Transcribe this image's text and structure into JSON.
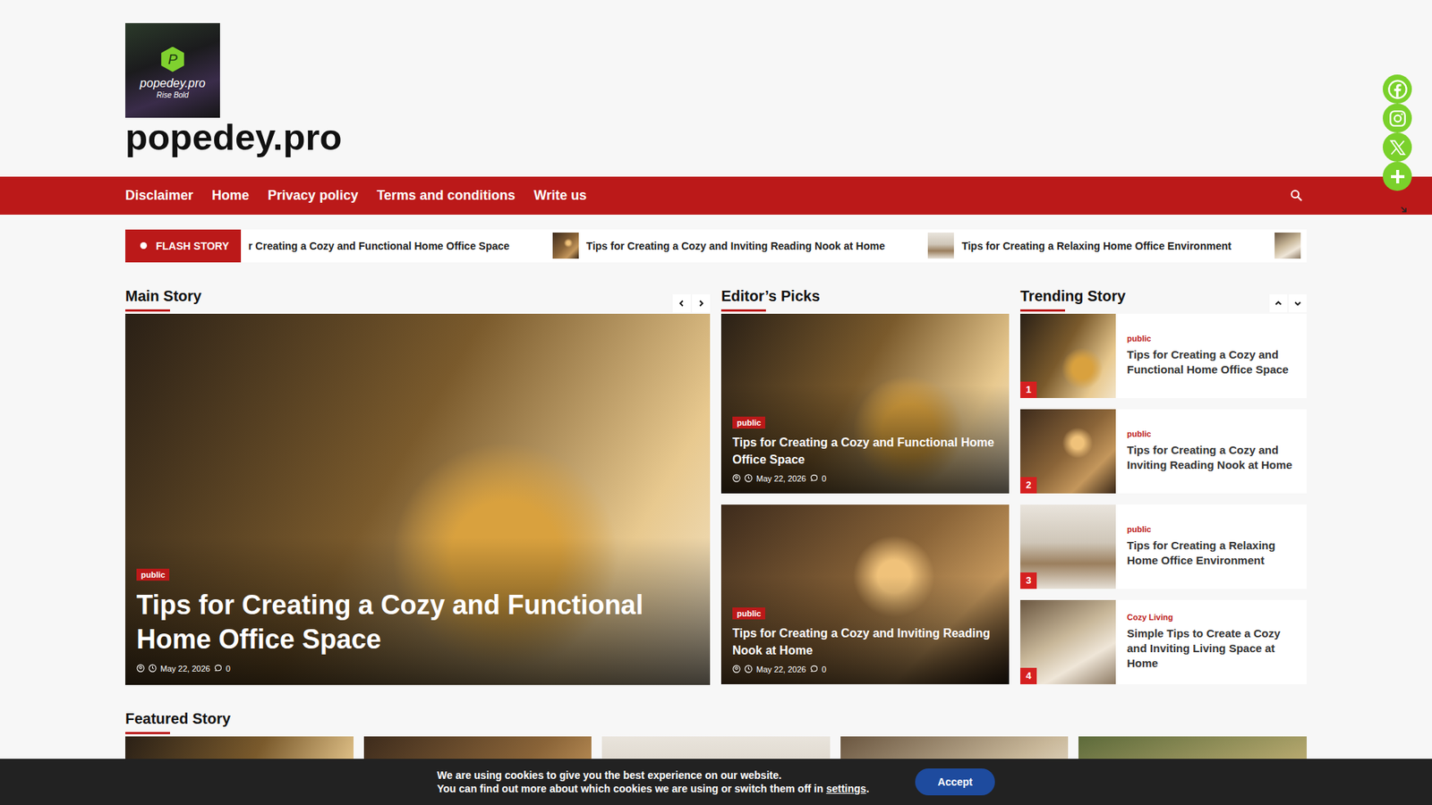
{
  "site": {
    "logo_letter": "P",
    "logo_name": "popedey.pro",
    "logo_tagline": "Rise Bold",
    "title": "popedey.pro"
  },
  "nav": {
    "items": [
      "Disclaimer",
      "Home",
      "Privacy policy",
      "Terms and conditions",
      "Write us"
    ]
  },
  "flash": {
    "label": "FLASH STORY",
    "items": [
      "r Creating a Cozy and Functional Home Office Space",
      "Tips for Creating a Cozy and Inviting Reading Nook at Home",
      "Tips for Creating a Relaxing Home Office Environment"
    ]
  },
  "main_story": {
    "title": "Main Story",
    "slide": {
      "category": "public",
      "title": "Tips for Creating a Cozy and Functional Home Office Space",
      "date": "May 22, 2026",
      "comments": "0"
    }
  },
  "editors_picks": {
    "title": "Editor’s Picks",
    "posts": [
      {
        "category": "public",
        "title": "Tips for Creating a Cozy and Functional Home Office Space",
        "date": "May 22, 2026",
        "comments": "0"
      },
      {
        "category": "public",
        "title": "Tips for Creating a Cozy and Inviting Reading Nook at Home",
        "date": "May 22, 2026",
        "comments": "0"
      }
    ]
  },
  "trending": {
    "title": "Trending Story",
    "posts": [
      {
        "rank": "1",
        "category": "public",
        "title": "Tips for Creating a Cozy and Functional Home Office Space"
      },
      {
        "rank": "2",
        "category": "public",
        "title": "Tips for Creating a Cozy and Inviting Reading Nook at Home"
      },
      {
        "rank": "3",
        "category": "public",
        "title": "Tips for Creating a Relaxing Home Office Environment"
      },
      {
        "rank": "4",
        "category": "Cozy Living",
        "title": "Simple Tips to Create a Cozy and Inviting Living Space at Home"
      }
    ]
  },
  "featured": {
    "title": "Featured Story"
  },
  "cookie": {
    "line1": "We are using cookies to give you the best experience on our website.",
    "line2": "You can find out more about which cookies we are using or switch them off in ",
    "link": "settings",
    "line2_end": ".",
    "button": "Accept"
  }
}
